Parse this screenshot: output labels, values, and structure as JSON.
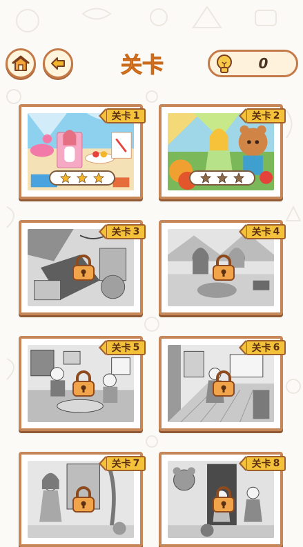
{
  "header": {
    "title": "关卡",
    "hints_count": "0"
  },
  "levels": [
    {
      "label": "关卡",
      "number": "1",
      "locked": false,
      "stars": 3,
      "star_color": "#f5b52a"
    },
    {
      "label": "关卡",
      "number": "2",
      "locked": false,
      "stars": 3,
      "star_color": "#8a6a4a"
    },
    {
      "label": "关卡",
      "number": "3",
      "locked": true
    },
    {
      "label": "关卡",
      "number": "4",
      "locked": true
    },
    {
      "label": "关卡",
      "number": "5",
      "locked": true
    },
    {
      "label": "关卡",
      "number": "6",
      "locked": true
    },
    {
      "label": "关卡",
      "number": "7",
      "locked": true
    },
    {
      "label": "关卡",
      "number": "8",
      "locked": true
    }
  ],
  "colors": {
    "accent": "#e88a2a",
    "frame": "#c68658",
    "badge": "#f3c23a"
  }
}
